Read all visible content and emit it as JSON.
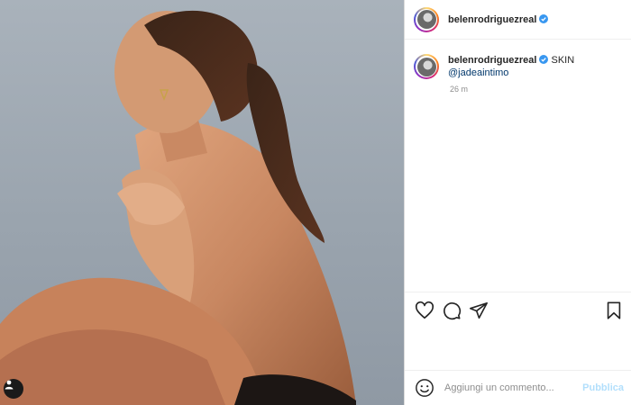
{
  "post": {
    "username": "belenrodriguezreal",
    "verified": true,
    "caption": "SKIN",
    "mention": "@jadeaintimo",
    "timestamp": "26 m"
  },
  "comment": {
    "placeholder": "Aggiungi un commento...",
    "publish_label": "Pubblica"
  },
  "colors": {
    "verified_badge": "#3897f0",
    "link": "#00376b",
    "publish_disabled": "#b2dffc",
    "muted_text": "#8e8e8e"
  },
  "icons": {
    "like": "heart-icon",
    "comment": "comment-icon",
    "share": "paper-plane-icon",
    "save": "bookmark-icon",
    "emoji": "smiley-icon",
    "tag": "person-tag-icon"
  }
}
